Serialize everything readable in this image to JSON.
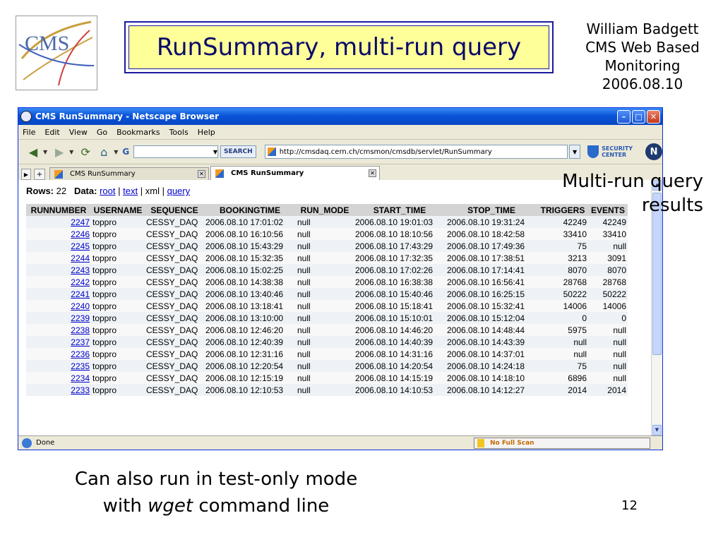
{
  "slide": {
    "logo_text": "CMS",
    "title": "RunSummary, multi-run query",
    "author_lines": [
      "William Badgett",
      "CMS Web Based",
      "Monitoring",
      "2006.08.10"
    ],
    "annotation_lines": [
      "Multi-run query",
      "results"
    ],
    "bottom_line1": "Can also run in test-only mode",
    "bottom_line2_prefix": "with ",
    "bottom_line2_em": "wget",
    "bottom_line2_suffix": " command line",
    "page_number": "12"
  },
  "window": {
    "title": "CMS RunSummary - Netscape Browser",
    "menu": [
      "File",
      "Edit",
      "View",
      "Go",
      "Bookmarks",
      "Tools",
      "Help"
    ],
    "search_button": "SEARCH",
    "search_engine_glyph": "G",
    "url": "http://cmsdaq.cern.ch/cmsmon/cmsdb/servlet/RunSummary",
    "security_line1": "SECURITY",
    "security_line2": "CENTER",
    "ns_logo": "N",
    "tabs": [
      {
        "label": "CMS RunSummary",
        "active": false
      },
      {
        "label": "CMS RunSummary",
        "active": true
      }
    ],
    "status": "Done",
    "scan_status": "No Full Scan",
    "icons": {
      "back": "back-arrow-icon",
      "forward": "forward-arrow-icon",
      "reload": "reload-icon",
      "home": "home-icon"
    }
  },
  "page": {
    "rows_label": "Rows:",
    "rows_count": "22",
    "data_label": "Data:",
    "links": {
      "root": "root",
      "text": "text",
      "xml": "xml",
      "query": "query"
    },
    "separator": "|",
    "columns": [
      "RUNNUMBER",
      "USERNAME",
      "SEQUENCE",
      "BOOKINGTIME",
      "RUN_MODE",
      "START_TIME",
      "STOP_TIME",
      "TRIGGERS",
      "EVENTS"
    ],
    "rows": [
      [
        "2247",
        "toppro",
        "CESSY_DAQ",
        "2006.08.10 17:01:02",
        "null",
        "2006.08.10 19:01:03",
        "2006.08.10 19:31:24",
        "42249",
        "42249"
      ],
      [
        "2246",
        "toppro",
        "CESSY_DAQ",
        "2006.08.10 16:10:56",
        "null",
        "2006.08.10 18:10:56",
        "2006.08.10 18:42:58",
        "33410",
        "33410"
      ],
      [
        "2245",
        "toppro",
        "CESSY_DAQ",
        "2006.08.10 15:43:29",
        "null",
        "2006.08.10 17:43:29",
        "2006.08.10 17:49:36",
        "75",
        "null"
      ],
      [
        "2244",
        "toppro",
        "CESSY_DAQ",
        "2006.08.10 15:32:35",
        "null",
        "2006.08.10 17:32:35",
        "2006.08.10 17:38:51",
        "3213",
        "3091"
      ],
      [
        "2243",
        "toppro",
        "CESSY_DAQ",
        "2006.08.10 15:02:25",
        "null",
        "2006.08.10 17:02:26",
        "2006.08.10 17:14:41",
        "8070",
        "8070"
      ],
      [
        "2242",
        "toppro",
        "CESSY_DAQ",
        "2006.08.10 14:38:38",
        "null",
        "2006.08.10 16:38:38",
        "2006.08.10 16:56:41",
        "28768",
        "28768"
      ],
      [
        "2241",
        "toppro",
        "CESSY_DAQ",
        "2006.08.10 13:40:46",
        "null",
        "2006.08.10 15:40:46",
        "2006.08.10 16:25:15",
        "50222",
        "50222"
      ],
      [
        "2240",
        "toppro",
        "CESSY_DAQ",
        "2006.08.10 13:18:41",
        "null",
        "2006.08.10 15:18:41",
        "2006.08.10 15:32:41",
        "14006",
        "14006"
      ],
      [
        "2239",
        "toppro",
        "CESSY_DAQ",
        "2006.08.10 13:10:00",
        "null",
        "2006.08.10 15:10:01",
        "2006.08.10 15:12:04",
        "0",
        "0"
      ],
      [
        "2238",
        "toppro",
        "CESSY_DAQ",
        "2006.08.10 12:46:20",
        "null",
        "2006.08.10 14:46:20",
        "2006.08.10 14:48:44",
        "5975",
        "null"
      ],
      [
        "2237",
        "toppro",
        "CESSY_DAQ",
        "2006.08.10 12:40:39",
        "null",
        "2006.08.10 14:40:39",
        "2006.08.10 14:43:39",
        "null",
        "null"
      ],
      [
        "2236",
        "toppro",
        "CESSY_DAQ",
        "2006.08.10 12:31:16",
        "null",
        "2006.08.10 14:31:16",
        "2006.08.10 14:37:01",
        "null",
        "null"
      ],
      [
        "2235",
        "toppro",
        "CESSY_DAQ",
        "2006.08.10 12:20:54",
        "null",
        "2006.08.10 14:20:54",
        "2006.08.10 14:24:18",
        "75",
        "null"
      ],
      [
        "2234",
        "toppro",
        "CESSY_DAQ",
        "2006.08.10 12:15:19",
        "null",
        "2006.08.10 14:15:19",
        "2006.08.10 14:18:10",
        "6896",
        "null"
      ],
      [
        "2233",
        "toppro",
        "CESSY_DAQ",
        "2006.08.10 12:10:53",
        "null",
        "2006.08.10 14:10:53",
        "2006.08.10 14:12:27",
        "2014",
        "2014"
      ]
    ]
  }
}
